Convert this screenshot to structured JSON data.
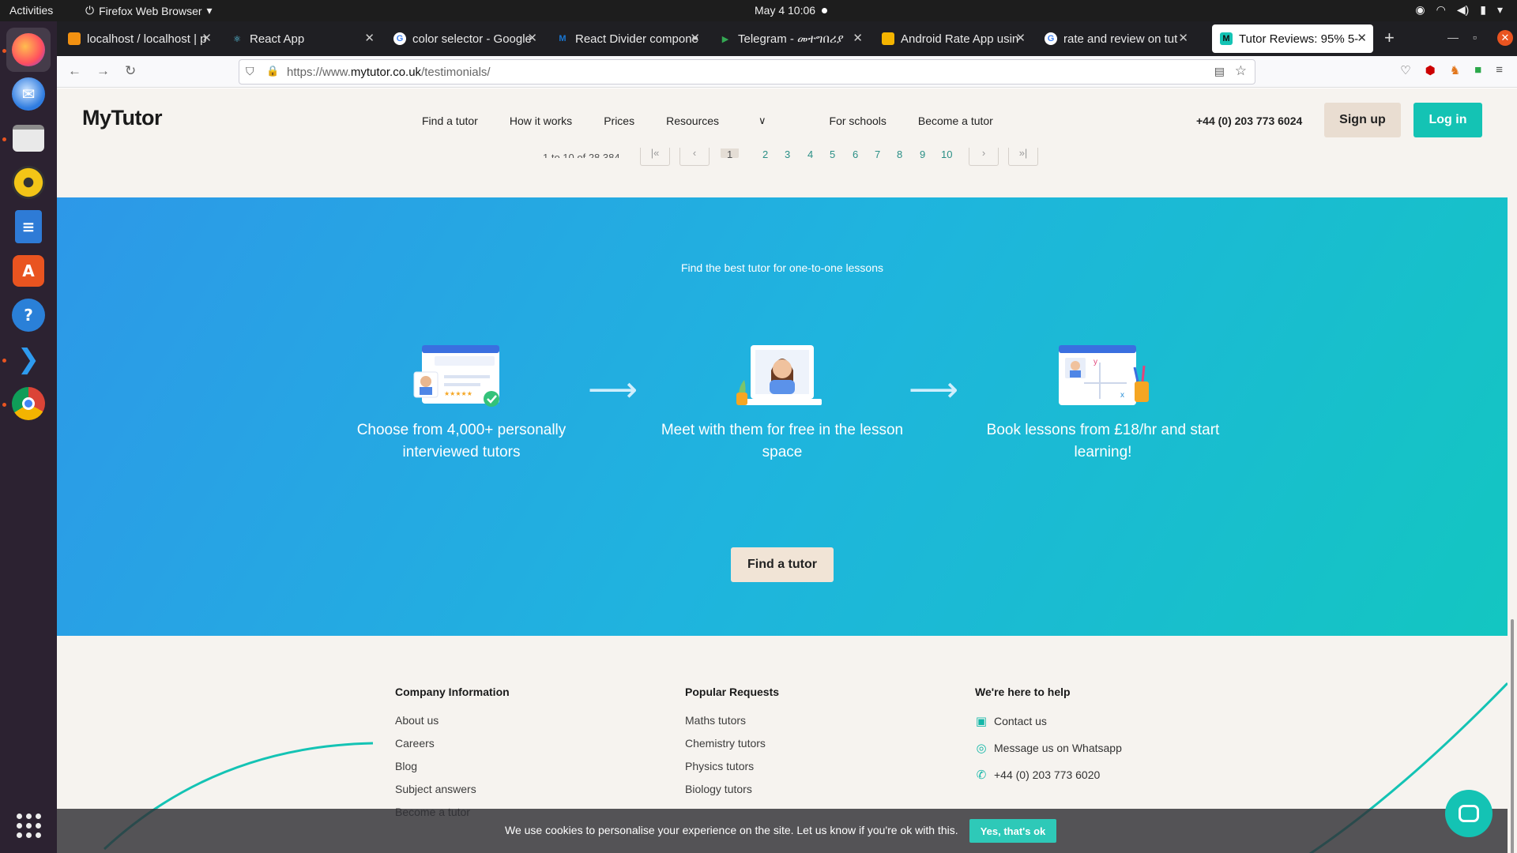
{
  "topbar": {
    "activities": "Activities",
    "app_name": "Firefox Web Browser",
    "clock": "May 4  10:06"
  },
  "dock": {
    "apps": [
      "firefox",
      "thunderbird",
      "files",
      "rhythmbox",
      "writer",
      "software",
      "help",
      "vscode",
      "chrome",
      "show-apps"
    ]
  },
  "browser": {
    "tabs": [
      {
        "title": "localhost / localhost | p"
      },
      {
        "title": "React App"
      },
      {
        "title": "color selector - Google"
      },
      {
        "title": "React Divider compone"
      },
      {
        "title": "Telegram - መተግበሪያ"
      },
      {
        "title": "Android Rate App usin"
      },
      {
        "title": "rate and review on tut"
      },
      {
        "title": "Tutor Reviews: 95% 5-"
      }
    ],
    "url_prefix": "https://www.",
    "url_domain": "mytutor.co.uk",
    "url_path": "/testimonials/"
  },
  "site": {
    "logo": "MyTutor",
    "menu": [
      "Find a tutor",
      "How it works",
      "Prices",
      "Resources",
      "For schools",
      "Become a tutor"
    ],
    "phone": "+44 (0) 203 773 6024",
    "signup": "Sign up",
    "login": "Log in"
  },
  "pagination": {
    "count_text": "1 to 10 of 28,384",
    "pages": [
      "1",
      "2",
      "3",
      "4",
      "5",
      "6",
      "7",
      "8",
      "9",
      "10"
    ]
  },
  "hero": {
    "subtitle": "Find the best tutor for one-to-one lessons",
    "steps": [
      {
        "text": "Choose from 4,000+ personally interviewed tutors"
      },
      {
        "text": "Meet with them for free in the lesson space"
      },
      {
        "text": "Book lessons from £18/hr and start learning!"
      }
    ],
    "cta": "Find a tutor"
  },
  "footer": {
    "company": {
      "heading": "Company Information",
      "links": [
        "About us",
        "Careers",
        "Blog",
        "Subject answers",
        "Become a tutor"
      ]
    },
    "popular": {
      "heading": "Popular Requests",
      "links": [
        "Maths tutors",
        "Chemistry tutors",
        "Physics tutors",
        "Biology tutors"
      ]
    },
    "help": {
      "heading": "We're here to help",
      "contact": "Contact us",
      "whatsapp": "Message us on Whatsapp",
      "phone": "+44 (0) 203 773 6020"
    }
  },
  "cookie": {
    "text": "We use cookies to personalise your experience on the site. Let us know if you're ok with this.",
    "accept": "Yes, that's ok"
  },
  "colors": {
    "accent": "#14c3b4",
    "hero_start": "#2d98e8",
    "hero_end": "#13c6c1",
    "page_bg": "#f6f3ef"
  }
}
